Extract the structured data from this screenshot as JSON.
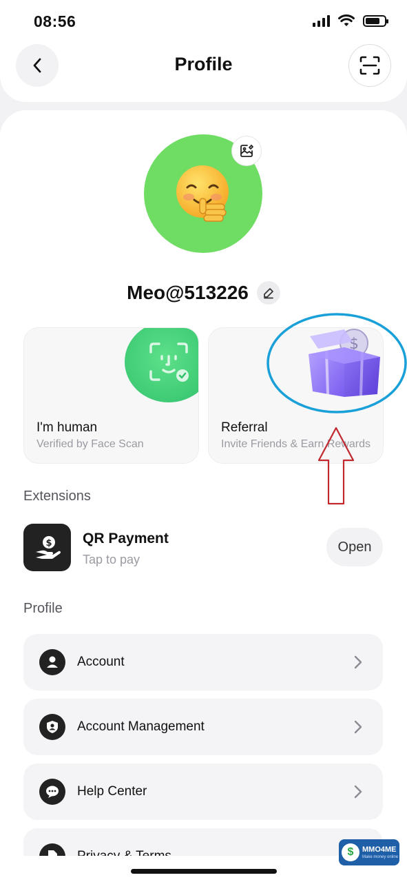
{
  "status_bar": {
    "time": "08:56",
    "battery_level": 0.75
  },
  "header": {
    "title": "Profile",
    "back_icon": "chevron-left-icon",
    "scan_icon": "scan-frame-icon"
  },
  "profile": {
    "username": "Meo@513226",
    "avatar_icon": "smiling-face-emoji",
    "avatar_color": "#6fdc63"
  },
  "cards": [
    {
      "title": "I'm human",
      "subtitle": "Verified by Face Scan",
      "icon": "face-scan-icon"
    },
    {
      "title": "Referral",
      "subtitle": "Invite Friends & Earn Rewards",
      "icon": "gift-box-icon"
    }
  ],
  "extensions": {
    "heading": "Extensions",
    "items": [
      {
        "title": "QR Payment",
        "subtitle": "Tap to pay",
        "action": "Open",
        "icon": "hand-coin-icon"
      }
    ]
  },
  "profile_section": {
    "heading": "Profile",
    "items": [
      {
        "label": "Account",
        "icon": "user-icon"
      },
      {
        "label": "Account Management",
        "icon": "shield-user-icon"
      },
      {
        "label": "Help Center",
        "icon": "chat-support-icon"
      },
      {
        "label": "Privacy & Terms",
        "icon": "document-icon"
      }
    ]
  },
  "annotations": {
    "ellipse_color": "#1aa0d8",
    "arrow_color": "#c0282e"
  },
  "watermark": {
    "name": "MMO4ME",
    "tagline": "Make money online"
  }
}
